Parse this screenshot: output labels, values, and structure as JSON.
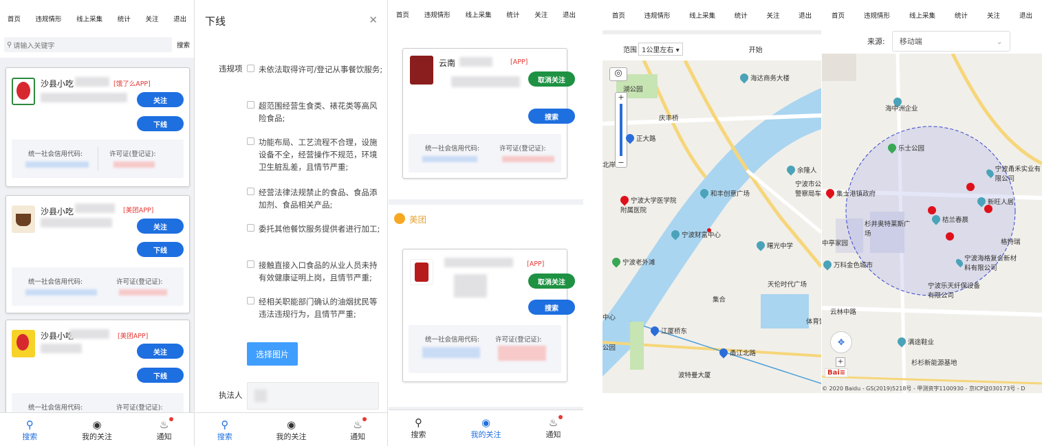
{
  "colors": {
    "primary": "#1e6fe0",
    "success": "#1e9142",
    "danger": "#e53935",
    "meituan": "#f7a823"
  },
  "nav": {
    "home": "首页",
    "violation": "违规情形",
    "online": "线上采集",
    "stats": "统计",
    "follow": "关注",
    "logout": "退出"
  },
  "search": {
    "placeholder": "请输入关键字",
    "button": "搜索"
  },
  "cards": [
    {
      "name": "沙县小吃",
      "tag": "[饿了么APP]",
      "follow": "关注",
      "offline": "下线",
      "credit_label": "统一社会信用代码:",
      "license_label": "许可证(登记证):"
    },
    {
      "name": "沙县小吃",
      "tag": "[美团APP]",
      "follow": "关注",
      "offline": "下线",
      "credit_label": "统一社会信用代码:",
      "license_label": "许可证(登记证):"
    },
    {
      "name": "沙县小吃",
      "tag": "[美团APP]",
      "follow": "关注",
      "offline": "下线",
      "credit_label": "统一社会信用代码:",
      "license_label": "许可证(登记证):"
    }
  ],
  "tabs": {
    "search": "搜索",
    "my_follow": "我的关注",
    "notice": "通知"
  },
  "dialog": {
    "title": "下线",
    "violation_label": "违规项",
    "options": [
      "未依法取得许可/登记从事餐饮服务;",
      "超范围经营生食类、裱花类等高风险食品;",
      "功能布局、工艺流程不合理，设施设备不全，经营操作不规范，环境卫生脏乱差，且情节严重;",
      "经营法律法规禁止的食品、食品添加剂、食品相关产品;",
      "委托其他餐饮服务提供者进行加工;",
      "接触直接入口食品的从业人员未持有效健康证明上岗，且情节严重;",
      "经相关职能部门确认的油烟扰民等违法违规行为，且情节严重;"
    ],
    "pick_image": "选择图片",
    "executor_label": "执法人"
  },
  "follow_page": {
    "cards": [
      {
        "name_prefix": "云南",
        "tag": "[APP]",
        "unfollow": "取消关注",
        "search": "搜索",
        "credit_label": "统一社会信用代码:",
        "license_label": "许可证(登记证):"
      },
      {
        "tag": "[APP]",
        "unfollow": "取消关注",
        "search": "搜索",
        "credit_label": "统一社会信用代码:",
        "license_label": "许可证(登记证):"
      }
    ],
    "meituan_label": "美团"
  },
  "map1": {
    "range_label": "范围",
    "range_value": "1公里左右",
    "start": "开始",
    "pois": [
      "海达商务大楼",
      "庆丰桥",
      "正大路",
      "余隆人",
      "宁波市公安",
      "警察局车辆",
      "和丰创意广场",
      "宁波大学医学院",
      "附属医院",
      "宁波财富中心",
      "宁波老外滩",
      "曙光中学",
      "天伦时代广场",
      "集合",
      "体育馆",
      "江厦桥东",
      "中心",
      "甬江北路",
      "波特曼大厦",
      "公园",
      "湖公园",
      "北岸"
    ]
  },
  "map2": {
    "source_label": "来源:",
    "source_value": "移动端",
    "pois": [
      "海中洲企业",
      "乐士公园",
      "集士港镇政府",
      "宁波甬禾实业有限公司",
      "新旺人居",
      "杉井奥特莱斯广场",
      "桔兰春晨",
      "宁波海格复合新材料有限公司",
      "格特瑞",
      "万科金色城市",
      "宁波乐天纤保设备有限公司",
      "云林中路",
      "满途鞋业",
      "杉杉新能源基地",
      "中亭家园"
    ],
    "copyright": "© 2020 Baidu - GS(2019)5218号 - 甲测资字1100930 - 京ICP证030173号 - D"
  }
}
